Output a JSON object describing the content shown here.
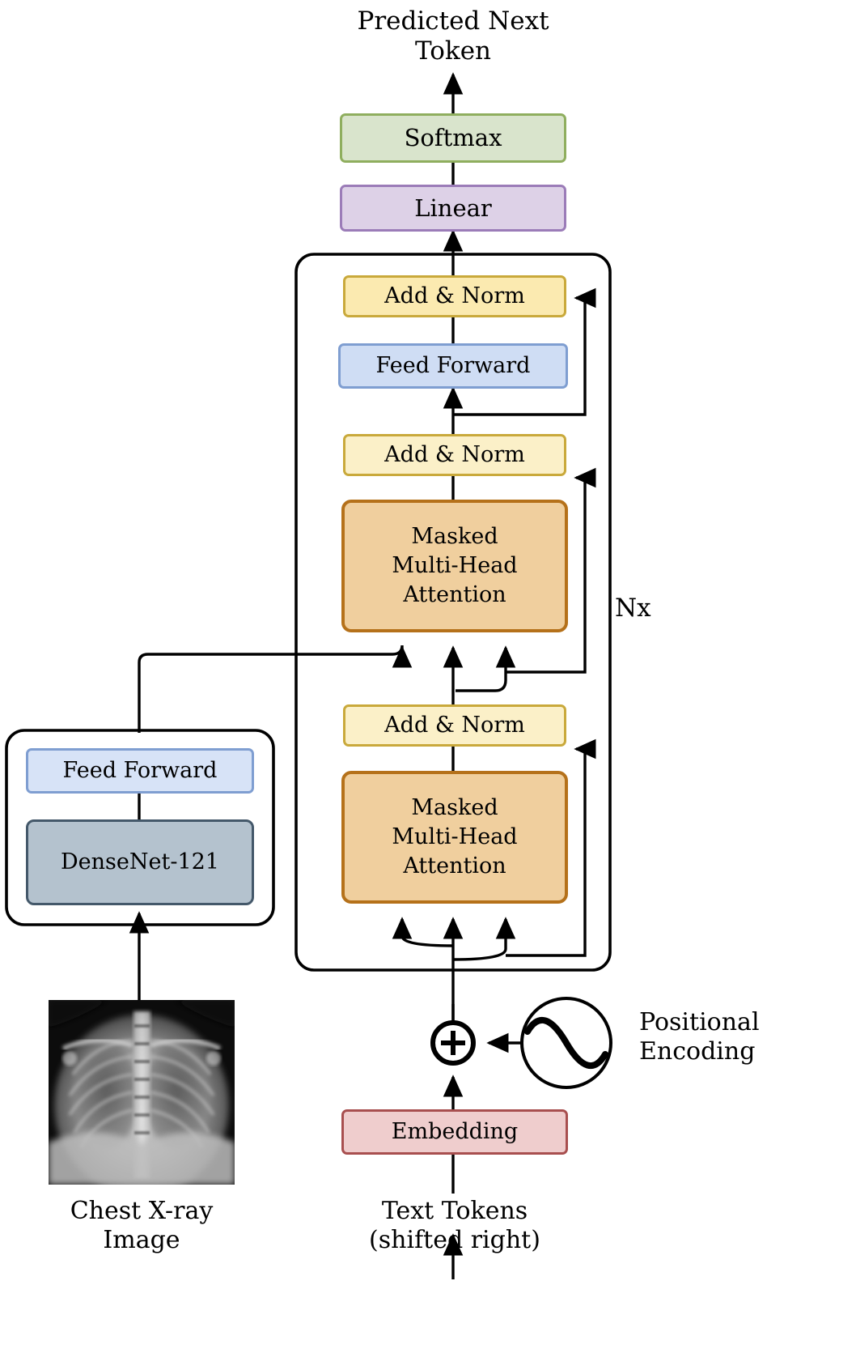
{
  "diagram": {
    "title": "Multimodal Transformer Decoder for Chest X-ray Report Generation",
    "type": "architecture-block-diagram",
    "labels": {
      "output": "Predicted Next\nToken",
      "output_line1": "Predicted Next",
      "output_line2": "Token",
      "repeat": "Nx",
      "positional_line1": "Positional",
      "positional_line2": "Encoding",
      "image_input_line1": "Chest X-ray",
      "image_input_line2": "Image",
      "text_input_line1": "Text Tokens",
      "text_input_line2": "(shifted right)",
      "plus_symbol": "+"
    },
    "blocks": [
      {
        "id": "softmax",
        "label": "Softmax",
        "fill": "#d9e4cc",
        "stroke": "#8fae5e"
      },
      {
        "id": "linear",
        "label": "Linear",
        "fill": "#ddd1e7",
        "stroke": "#9b7cb8"
      },
      {
        "id": "addnorm_top",
        "label": "Add & Norm",
        "fill": "#fbeab0",
        "stroke": "#c9a93b"
      },
      {
        "id": "feedforward_dec",
        "label": "Feed Forward",
        "fill": "#cfddf4",
        "stroke": "#7f9ed1"
      },
      {
        "id": "addnorm_mid",
        "label": "Add & Norm",
        "fill": "#fbf0c8",
        "stroke": "#c9a93b"
      },
      {
        "id": "cross_attention",
        "label": "Masked\nMulti-Head\nAttention",
        "fill": "#f0cf9e",
        "stroke": "#b5711a"
      },
      {
        "id": "addnorm_low",
        "label": "Add & Norm",
        "fill": "#fbf0c8",
        "stroke": "#c9a93b"
      },
      {
        "id": "self_attention",
        "label": "Masked\nMulti-Head\nAttention",
        "fill": "#f0cf9e",
        "stroke": "#b5711a"
      },
      {
        "id": "embedding",
        "label": "Embedding",
        "fill": "#efcdcd",
        "stroke": "#a84f4f"
      },
      {
        "id": "feedforward_enc",
        "label": "Feed Forward",
        "fill": "#d7e3f7",
        "stroke": "#7f9ed1"
      },
      {
        "id": "densenet",
        "label": "DenseNet-121",
        "fill": "#b4c2ce",
        "stroke": "#44586a"
      }
    ],
    "block_text": {
      "softmax": "Softmax",
      "linear": "Linear",
      "addnorm_top": "Add & Norm",
      "feedforward_dec": "Feed Forward",
      "addnorm_mid": "Add & Norm",
      "cross_attention_l1": "Masked",
      "cross_attention_l2": "Multi-Head",
      "cross_attention_l3": "Attention",
      "addnorm_low": "Add & Norm",
      "self_attention_l1": "Masked",
      "self_attention_l2": "Multi-Head",
      "self_attention_l3": "Attention",
      "embedding": "Embedding",
      "feedforward_enc": "Feed Forward",
      "densenet": "DenseNet-121"
    },
    "colors": {
      "wire": "#000000",
      "background": "#ffffff",
      "green_fill": "#d9e4cc",
      "green_stroke": "#8fae5e",
      "purple_fill": "#ddd1e7",
      "purple_stroke": "#9b7cb8",
      "yellow_fill": "#fbeab0",
      "yellow_stroke": "#c9a93b",
      "blue_fill": "#cfddf4",
      "blue_stroke": "#7f9ed1",
      "orange_fill": "#f0cf9e",
      "orange_stroke": "#b5711a",
      "red_fill": "#efcdcd",
      "red_stroke": "#a84f4f",
      "gray_fill": "#b4c2ce",
      "gray_stroke": "#44586a"
    }
  }
}
